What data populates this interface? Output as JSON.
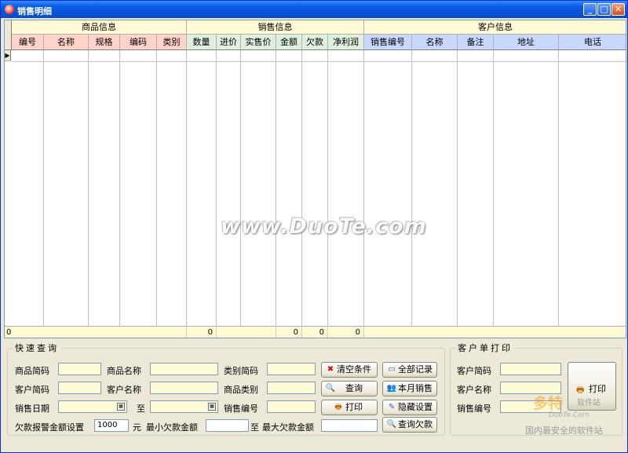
{
  "window": {
    "title": "销售明细",
    "min_glyph": "_",
    "max_glyph": "□",
    "close_glyph": "✕"
  },
  "grid": {
    "groups": [
      "商品信息",
      "销售信息",
      "客户信息"
    ],
    "goods_columns": [
      "编号",
      "名称",
      "规格",
      "编码",
      "类别"
    ],
    "sales_columns": [
      "数量",
      "进价",
      "实售价",
      "金额",
      "欠款",
      "净利润"
    ],
    "customer_columns": [
      "销售编号",
      "名称",
      "备注",
      "地址",
      "电话"
    ],
    "current_row_marker": "▶",
    "footer": {
      "count": "0",
      "quantity_total": "0",
      "amount_total": "0",
      "debt_total": "0",
      "profit_total": "0"
    },
    "watermark": "www.DuoTe.com"
  },
  "quick_query": {
    "legend": "快速查询",
    "labels": {
      "product_short": "商品简码",
      "product_name": "商品名称",
      "category_short": "类别简码",
      "customer_short": "客户简码",
      "customer_name": "客户名称",
      "product_category": "商品类别",
      "sale_date": "销售日期",
      "to": "至",
      "sale_no": "销售编号",
      "debt_alert": "欠款报警金额设置",
      "unit": "元",
      "min_debt": "最小欠款金额",
      "to2": "至",
      "max_debt": "最大欠款金额"
    },
    "debt_alert_value": "1000",
    "buttons": {
      "clear": "清空条件",
      "all_records": "全部记录",
      "query": "查询",
      "this_month": "本月销售",
      "print": "打印",
      "hide_settings": "隐藏设置",
      "query_debt": "查询欠款"
    },
    "icons": {
      "clear": "red-x-icon",
      "all_records": "window-icon",
      "query": "magnifier-icon",
      "this_month": "people-icon",
      "print": "printer-icon",
      "hide_settings": "pencil-icon",
      "query_debt": "magnifier-icon"
    }
  },
  "customer_print": {
    "legend": "客户单打印",
    "labels": {
      "customer_short": "客户简码",
      "customer_name": "客户名称",
      "sale_no": "销售编号"
    },
    "print_button": "打印"
  },
  "logo": {
    "brand": "多特",
    "tag": "软件站",
    "site": "DuoTe.Com",
    "slogan": "国内最安全的软件站"
  }
}
